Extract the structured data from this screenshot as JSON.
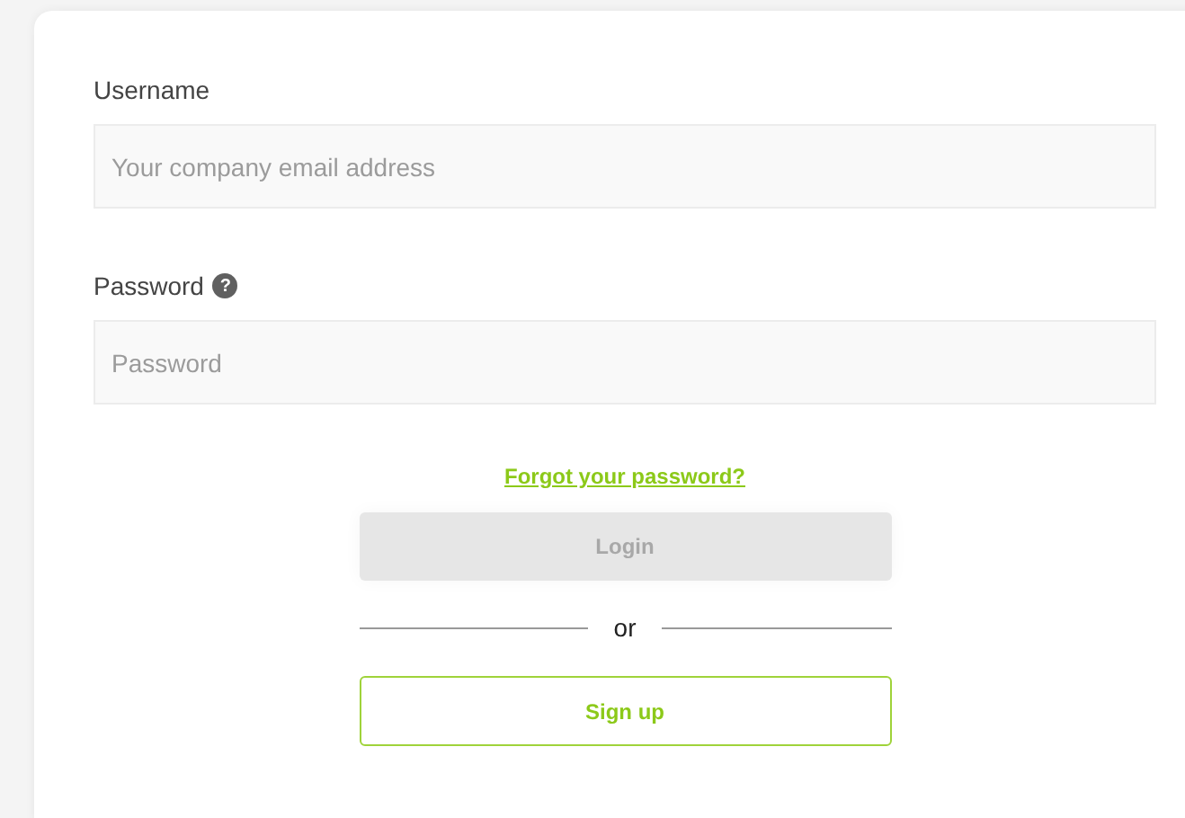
{
  "fields": [
    {
      "label": "Username",
      "placeholder": "Your company email address"
    },
    {
      "label": "Password",
      "placeholder": "Password",
      "help_icon": "?"
    }
  ],
  "forgot_link": "Forgot your password?",
  "login_button": {
    "label": "Login",
    "disabled": true
  },
  "separator": "or",
  "signup_button": {
    "label": "Sign up"
  }
}
